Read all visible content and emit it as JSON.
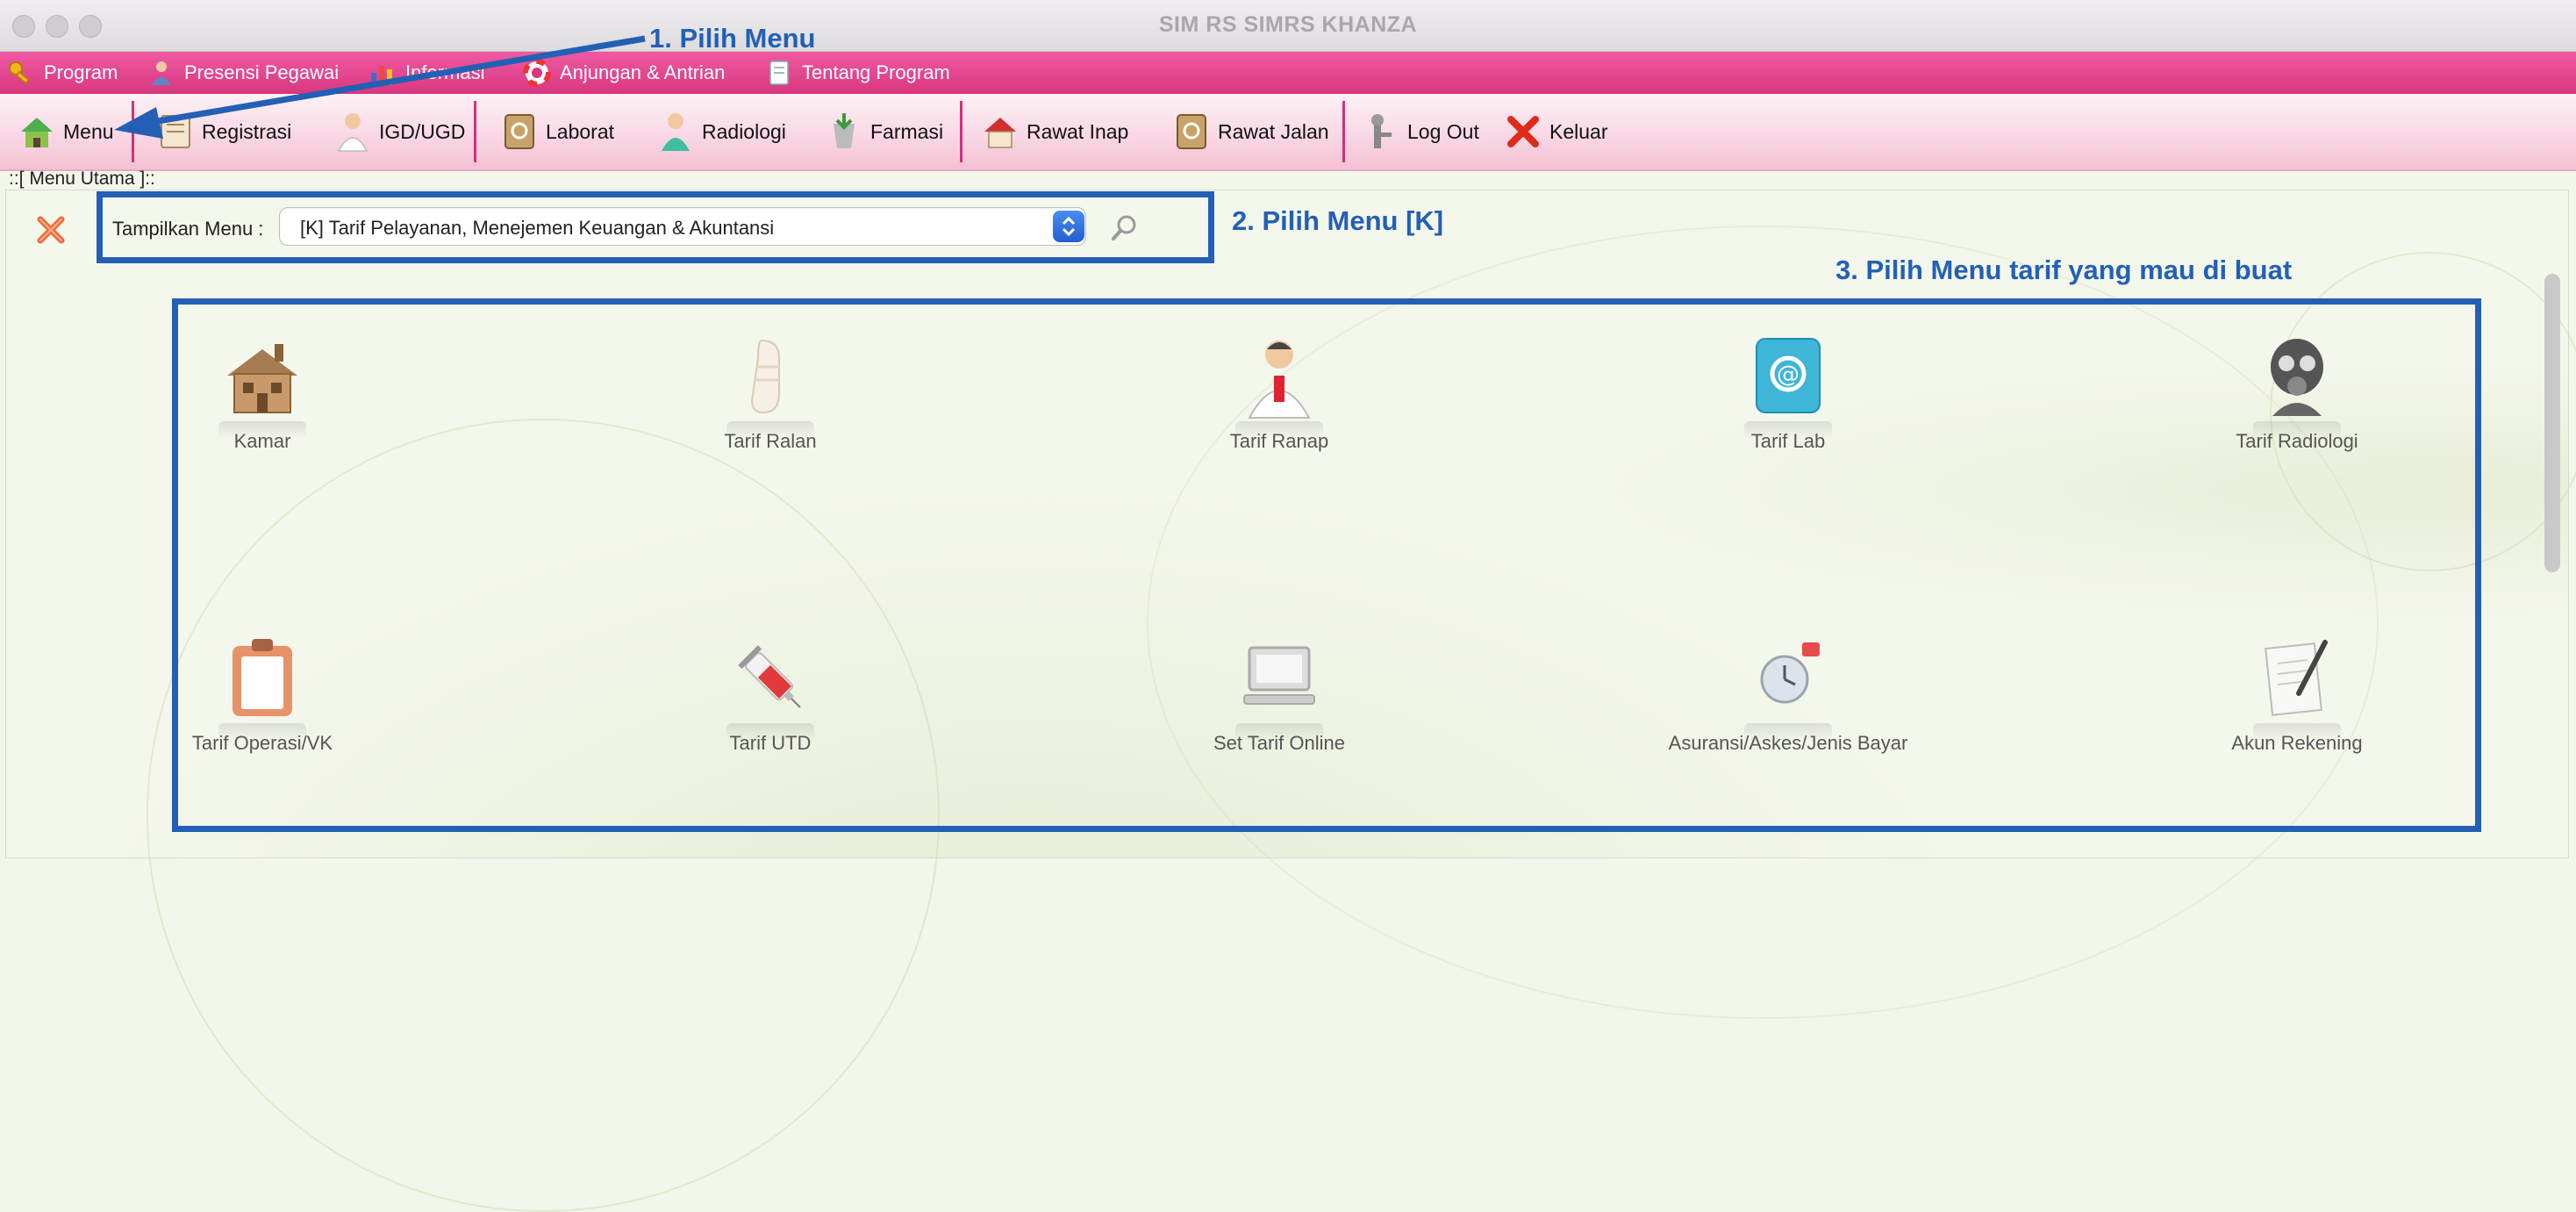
{
  "window": {
    "title": "SIM RS SIMRS KHANZA"
  },
  "menubar": {
    "items": [
      {
        "label": "Program",
        "icon": "key-icon"
      },
      {
        "label": "Presensi Pegawai",
        "icon": "employee-icon"
      },
      {
        "label": "Informasi",
        "icon": "chart-icon"
      },
      {
        "label": "Anjungan & Antrian",
        "icon": "lifebuoy-icon"
      },
      {
        "label": "Tentang Program",
        "icon": "document-icon"
      }
    ]
  },
  "toolbar": {
    "items": [
      {
        "label": "Menu",
        "icon": "home-icon"
      },
      {
        "label": "Registrasi",
        "icon": "register-icon"
      },
      {
        "label": "IGD/UGD",
        "icon": "doctor-icon"
      },
      {
        "label": "Laborat",
        "icon": "lab-icon"
      },
      {
        "label": "Radiologi",
        "icon": "nurse-icon"
      },
      {
        "label": "Farmasi",
        "icon": "pharmacy-icon"
      },
      {
        "label": "Rawat Inap",
        "icon": "house-icon"
      },
      {
        "label": "Rawat Jalan",
        "icon": "outpatient-icon"
      },
      {
        "label": "Log Out",
        "icon": "logout-icon"
      },
      {
        "label": "Keluar",
        "icon": "red-x-icon"
      }
    ]
  },
  "panel": {
    "title": "::[ Menu Utama ]::",
    "select_label": "Tampilkan Menu :",
    "selected_menu": "[K] Tarif Pelayanan, Menejemen Keuangan & Akuntansi"
  },
  "annotations": {
    "step1": "1. Pilih Menu",
    "step2": "2. Pilih Menu [K]",
    "step3": "3. Pilih Menu tarif yang mau di buat"
  },
  "grid": {
    "items": [
      {
        "label": "Kamar",
        "icon": "building-icon"
      },
      {
        "label": "Tarif Ralan",
        "icon": "bandage-icon"
      },
      {
        "label": "Tarif Ranap",
        "icon": "doctor-icon"
      },
      {
        "label": "Tarif Lab",
        "icon": "address-book-icon"
      },
      {
        "label": "Tarif Radiologi",
        "icon": "gasmask-icon"
      },
      {
        "label": "Tarif Operasi/VK",
        "icon": "clipboard-icon"
      },
      {
        "label": "Tarif UTD",
        "icon": "syringe-icon"
      },
      {
        "label": "Set Tarif Online",
        "icon": "computer-icon"
      },
      {
        "label": "Asuransi/Askes/Jenis Bayar",
        "icon": "alarm-icon"
      },
      {
        "label": "Akun Rekening",
        "icon": "pen-paper-icon"
      }
    ]
  },
  "colors": {
    "menubar": "#e0448c",
    "annotation": "#2360b5",
    "toolbar_separator": "#d3307a"
  }
}
